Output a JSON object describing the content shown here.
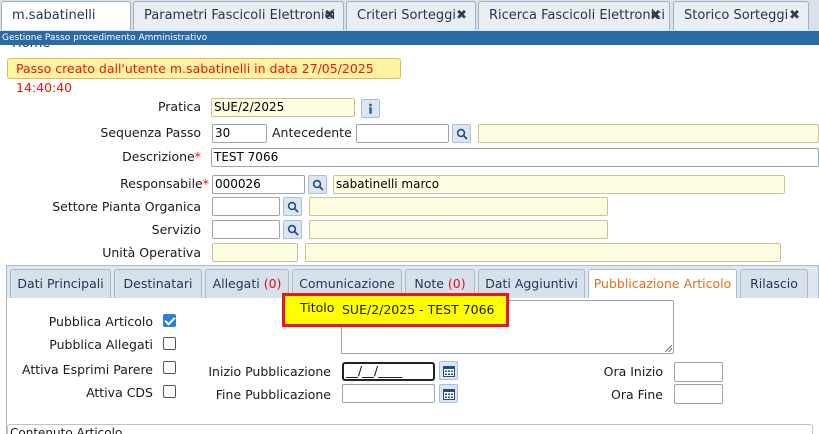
{
  "top_tabs": [
    {
      "label": "m.sabatinelli Home",
      "closable": false
    },
    {
      "label": "Parametri Fascicoli Elettronici",
      "closable": true
    },
    {
      "label": "Criteri Sorteggi",
      "closable": true
    },
    {
      "label": "Ricerca Fascicoli Elettronici",
      "closable": true
    },
    {
      "label": "Storico Sorteggi",
      "closable": true
    }
  ],
  "close_glyph": "✖",
  "window_title": "Gestione Passo procedimento Amministrativo",
  "banner": "Passo creato dall'utente m.sabatinelli in data 27/05/2025 14:40:40",
  "form": {
    "pratica": {
      "label": "Pratica",
      "value": "SUE/2/2025"
    },
    "sequenza": {
      "label": "Sequenza Passo",
      "value": "30"
    },
    "antecedente": {
      "label": "Antecedente",
      "value": "",
      "desc": ""
    },
    "descrizione": {
      "label": "Descrizione",
      "value": "TEST 7066"
    },
    "responsabile": {
      "label": "Responsabile",
      "code": "000026",
      "name": "sabatinelli marco"
    },
    "settore": {
      "label": "Settore Pianta Organica",
      "code": "",
      "desc": ""
    },
    "servizio": {
      "label": "Servizio",
      "code": "",
      "desc": ""
    },
    "unita": {
      "label": "Unità Operativa",
      "code": "",
      "desc": ""
    },
    "required_mark": "*"
  },
  "sub_tabs": [
    {
      "label": "Dati Principali",
      "count": ""
    },
    {
      "label": "Destinatari",
      "count": ""
    },
    {
      "label": "Allegati",
      "count": "(0)"
    },
    {
      "label": "Comunicazione",
      "count": ""
    },
    {
      "label": "Note",
      "count": "(0)"
    },
    {
      "label": "Dati Aggiuntivi",
      "count": ""
    },
    {
      "label": "Pubblicazione Articolo",
      "count": "",
      "active": true
    },
    {
      "label": "Rilascio",
      "count": ""
    }
  ],
  "pubblicazione": {
    "pubblica_articolo": {
      "label": "Pubblica Articolo",
      "checked": true
    },
    "pubblica_allegati": {
      "label": "Pubblica Allegati",
      "checked": false
    },
    "attiva_esprimi": {
      "label": "Attiva Esprimi Parere",
      "checked": false
    },
    "attiva_cds": {
      "label": "Attiva CDS",
      "checked": false
    },
    "titolo": {
      "label": "Titolo",
      "value": "SUE/2/2025 - TEST 7066"
    },
    "inizio": {
      "label": "Inizio Pubblicazione",
      "value": "__/__/____"
    },
    "fine": {
      "label": "Fine Pubblicazione",
      "value": ""
    },
    "ora_inizio": {
      "label": "Ora Inizio",
      "value": ""
    },
    "ora_fine": {
      "label": "Ora Fine",
      "value": ""
    },
    "contenuto_label": "Contenuto Articolo"
  },
  "colors": {
    "accent_blue": "#2a6aa6",
    "required": "#e01010",
    "active_tab": "#e07020",
    "highlight": "#ffff00",
    "highlight_border": "#e8171e"
  }
}
